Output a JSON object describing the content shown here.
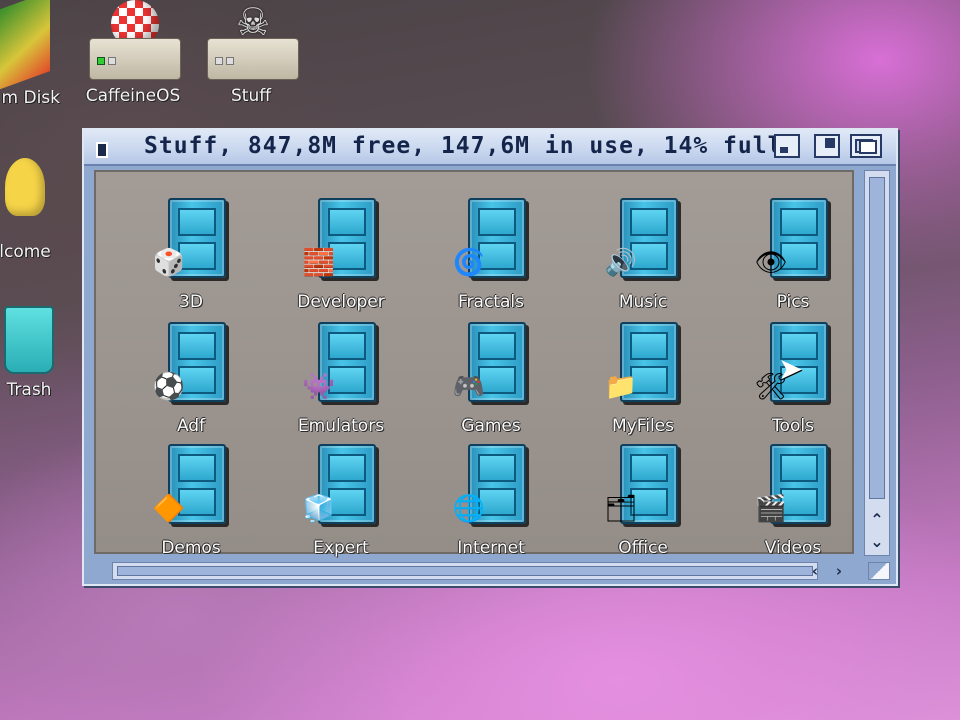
{
  "desktop": {
    "icons": [
      {
        "label": "m Disk"
      },
      {
        "label": "CaffeineOS"
      },
      {
        "label": "Stuff"
      },
      {
        "label": "lcome"
      },
      {
        "label": "Trash"
      }
    ]
  },
  "window": {
    "title": "Stuff,  847,8M free, 147,6M in use, 14% full",
    "drawers": [
      {
        "label": "3D",
        "icon": "die-icon",
        "glyph": "🎲"
      },
      {
        "label": "Developer",
        "icon": "blocks-icon",
        "glyph": "🧱"
      },
      {
        "label": "Fractals",
        "icon": "fractal-icon",
        "glyph": "🌀"
      },
      {
        "label": "Music",
        "icon": "speaker-icon",
        "glyph": "🔊"
      },
      {
        "label": "Pics",
        "icon": "eye-icon",
        "glyph": "👁"
      },
      {
        "label": "Adf",
        "icon": "checkerball-icon",
        "glyph": "⚽"
      },
      {
        "label": "Emulators",
        "icon": "character-icon",
        "glyph": "👾"
      },
      {
        "label": "Games",
        "icon": "gamepad-icon",
        "glyph": "🎮"
      },
      {
        "label": "MyFiles",
        "icon": "folder-user-icon",
        "glyph": "📁"
      },
      {
        "label": "Tools",
        "icon": "tools-icon",
        "glyph": "🛠"
      },
      {
        "label": "Demos",
        "icon": "demo-icon",
        "glyph": "🔶"
      },
      {
        "label": "Expert",
        "icon": "cubes-icon",
        "glyph": "🧊"
      },
      {
        "label": "Internet",
        "icon": "globe-icon",
        "glyph": "🌐"
      },
      {
        "label": "Office",
        "icon": "folder-icon",
        "glyph": "🗂"
      },
      {
        "label": "Videos",
        "icon": "clapper-icon",
        "glyph": "🎬"
      }
    ]
  },
  "colors": {
    "drawer_blue": "#48c5e8",
    "window_frame": "#8fa8d0",
    "content_bg": "#9c9591",
    "title_text": "#14244a"
  }
}
